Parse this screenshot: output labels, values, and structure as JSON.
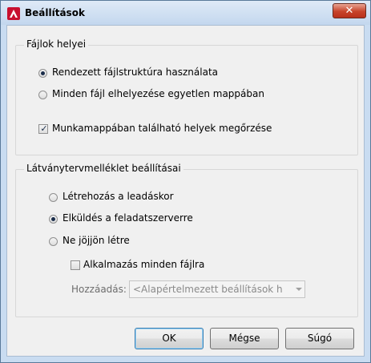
{
  "window": {
    "title": "Beállítások",
    "close_label": "✕",
    "icon": "autocad-a-icon",
    "colors": {
      "titlebar": "#c9dcf1",
      "close": "#c7432a",
      "app_icon": "#c8102e"
    }
  },
  "file_locations": {
    "title": "Fájlok helyei",
    "options": [
      {
        "label": "Rendezett fájlstruktúra használata",
        "checked": true
      },
      {
        "label": "Minden fájl elhelyezése egyetlen mappában",
        "checked": false
      }
    ],
    "keep_locations": {
      "label": "Munkamappában található helyek megőrzése",
      "checked": true
    }
  },
  "transmittal": {
    "title": "Látványtervmelléklet beállításai",
    "options": [
      {
        "label": "Létrehozás a leadáskor",
        "checked": false
      },
      {
        "label": "Elküldés a feladatszerverre",
        "checked": true
      },
      {
        "label": "Ne jöjjön létre",
        "checked": false
      }
    ],
    "apply_all": {
      "label": "Alkalmazás minden fájlra",
      "checked": false
    },
    "add_label": "Hozzáadás:",
    "add_value": "<Alapértelmezett beállítások használata>"
  },
  "buttons": {
    "ok": "OK",
    "cancel": "Mégse",
    "help": "Súgó"
  }
}
